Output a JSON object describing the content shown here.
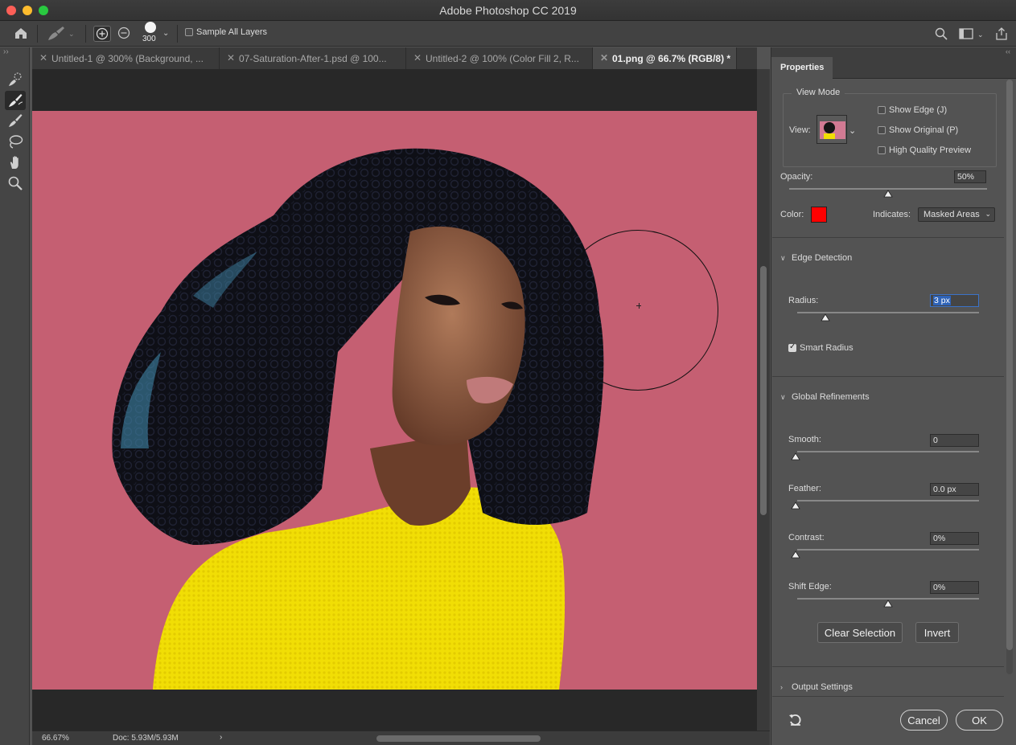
{
  "window": {
    "title": "Adobe Photoshop CC 2019"
  },
  "options_bar": {
    "brush_size": "300",
    "sample_all_layers": {
      "label": "Sample All Layers",
      "checked": false
    }
  },
  "tabs": [
    {
      "label": "Untitled-1 @ 300% (Background, ...",
      "active": false
    },
    {
      "label": "07-Saturation-After-1.psd @ 100...",
      "active": false
    },
    {
      "label": "Untitled-2 @ 100% (Color Fill 2, R...",
      "active": false
    },
    {
      "label": "01.png @ 66.7% (RGB/8) *",
      "active": true
    }
  ],
  "tools": [
    {
      "name": "quick-selection-tool"
    },
    {
      "name": "refine-edge-brush-tool",
      "selected": true
    },
    {
      "name": "brush-tool"
    },
    {
      "name": "lasso-tool"
    },
    {
      "name": "hand-tool"
    },
    {
      "name": "zoom-tool"
    }
  ],
  "status": {
    "zoom": "66.67%",
    "doc": "Doc: 5.93M/5.93M"
  },
  "properties": {
    "tab": "Properties",
    "view_mode": {
      "heading": "View Mode",
      "view_label": "View:",
      "show_edge": {
        "label": "Show Edge (J)",
        "checked": false
      },
      "show_original": {
        "label": "Show Original (P)",
        "checked": false
      },
      "high_quality_preview": {
        "label": "High Quality Preview",
        "checked": false
      }
    },
    "opacity": {
      "label": "Opacity:",
      "value": "50%",
      "level": 0.5
    },
    "color": {
      "label": "Color:",
      "swatch": "#ff0000"
    },
    "indicates": {
      "label": "Indicates:",
      "value": "Masked Areas"
    },
    "edge_detection": {
      "heading": "Edge Detection",
      "radius": {
        "label": "Radius:",
        "value": "3 px",
        "level": 0.16
      },
      "smart_radius": {
        "label": "Smart Radius",
        "checked": true
      }
    },
    "global_refinements": {
      "heading": "Global Refinements",
      "smooth": {
        "label": "Smooth:",
        "value": "0",
        "level": 0
      },
      "feather": {
        "label": "Feather:",
        "value": "0.0 px",
        "level": 0
      },
      "contrast": {
        "label": "Contrast:",
        "value": "0%",
        "level": 0
      },
      "shift_edge": {
        "label": "Shift Edge:",
        "value": "0%",
        "level": 0.5
      }
    },
    "clear_selection": "Clear Selection",
    "invert": "Invert",
    "output_settings": "Output Settings",
    "cancel": "Cancel",
    "ok": "OK"
  }
}
